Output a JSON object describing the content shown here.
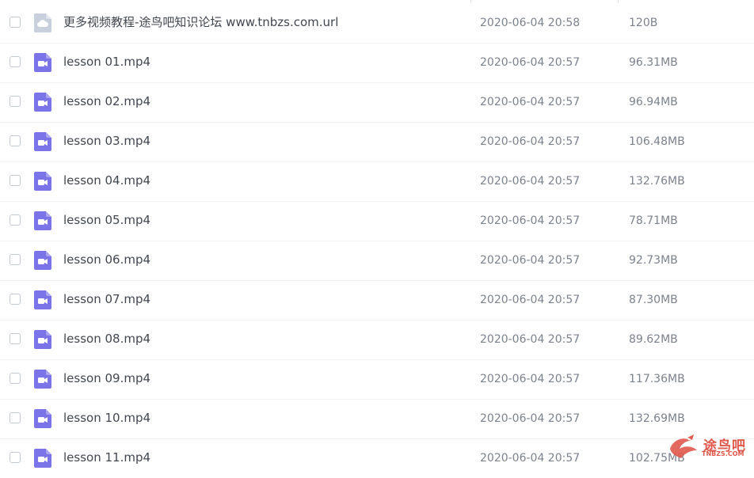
{
  "files": [
    {
      "name": "更多视频教程-途鸟吧知识论坛 www.tnbzs.com.url",
      "date": "2020-06-04 20:58",
      "size": "120B",
      "type": "link",
      "icon": "cloud-link-file-icon"
    },
    {
      "name": "lesson 01.mp4",
      "date": "2020-06-04 20:57",
      "size": "96.31MB",
      "type": "video",
      "icon": "video-file-icon"
    },
    {
      "name": "lesson 02.mp4",
      "date": "2020-06-04 20:57",
      "size": "96.94MB",
      "type": "video",
      "icon": "video-file-icon"
    },
    {
      "name": "lesson 03.mp4",
      "date": "2020-06-04 20:57",
      "size": "106.48MB",
      "type": "video",
      "icon": "video-file-icon"
    },
    {
      "name": "lesson 04.mp4",
      "date": "2020-06-04 20:57",
      "size": "132.76MB",
      "type": "video",
      "icon": "video-file-icon"
    },
    {
      "name": "lesson 05.mp4",
      "date": "2020-06-04 20:57",
      "size": "78.71MB",
      "type": "video",
      "icon": "video-file-icon"
    },
    {
      "name": "lesson 06.mp4",
      "date": "2020-06-04 20:57",
      "size": "92.73MB",
      "type": "video",
      "icon": "video-file-icon"
    },
    {
      "name": "lesson 07.mp4",
      "date": "2020-06-04 20:57",
      "size": "87.30MB",
      "type": "video",
      "icon": "video-file-icon"
    },
    {
      "name": "lesson 08.mp4",
      "date": "2020-06-04 20:57",
      "size": "89.62MB",
      "type": "video",
      "icon": "video-file-icon"
    },
    {
      "name": "lesson 09.mp4",
      "date": "2020-06-04 20:57",
      "size": "117.36MB",
      "type": "video",
      "icon": "video-file-icon"
    },
    {
      "name": "lesson 10.mp4",
      "date": "2020-06-04 20:57",
      "size": "132.69MB",
      "type": "video",
      "icon": "video-file-icon"
    },
    {
      "name": "lesson 11.mp4",
      "date": "2020-06-04 20:57",
      "size": "102.75MB",
      "type": "video",
      "icon": "video-file-icon"
    }
  ],
  "watermark": {
    "text": "途鸟吧",
    "subtext": "TNBZS.COM",
    "icon": "bird-logo-icon"
  },
  "colors": {
    "video_icon": "#7b73e8",
    "link_icon": "#c7d0dc",
    "watermark": "#e0584b"
  }
}
